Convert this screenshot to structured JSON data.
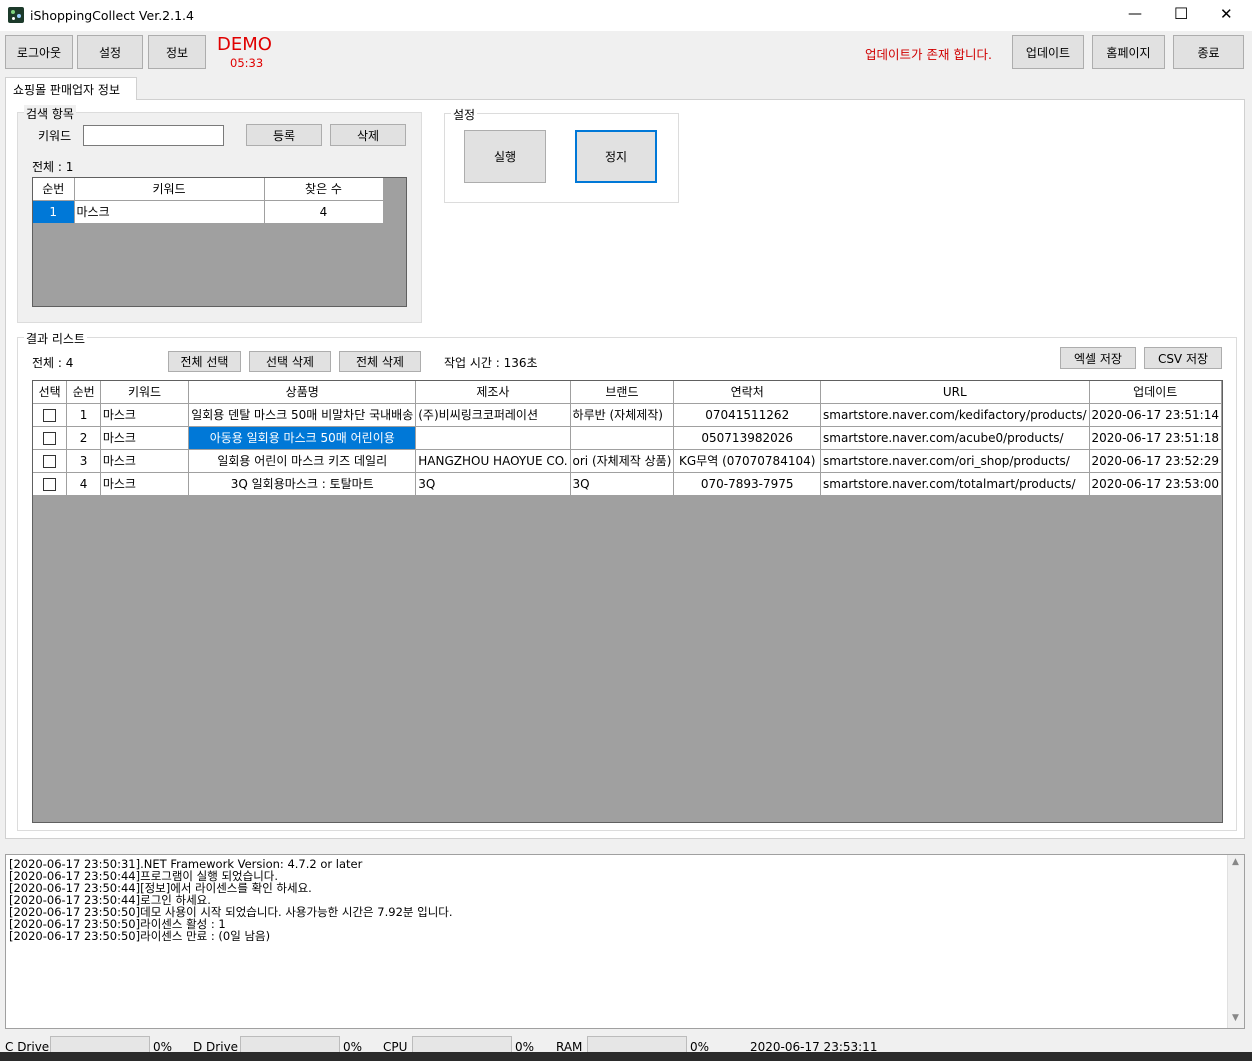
{
  "window": {
    "title": "iShoppingCollect Ver.2.1.4",
    "minimize": "—",
    "maximize": "☐",
    "close": "✕"
  },
  "toolbar": {
    "logout": "로그아웃",
    "settings": "설정",
    "info": "정보",
    "demo_label": "DEMO",
    "demo_timer": "05:33",
    "update_notice": "업데이트가 존재 합니다.",
    "update": "업데이트",
    "homepage": "홈페이지",
    "exit": "종료"
  },
  "tab": {
    "label": "쇼핑몰 판매업자 정보"
  },
  "search_group": {
    "title": "검색 항목",
    "keyword_label": "키워드",
    "keyword_value": "",
    "register": "등록",
    "delete": "삭제",
    "total": "전체 :  1",
    "columns": [
      "순번",
      "키워드",
      "찾은 수"
    ],
    "rows": [
      {
        "no": "1",
        "keyword": "마스크",
        "found": "4"
      }
    ]
  },
  "settings_group": {
    "title": "설정",
    "run": "실행",
    "stop": "정지"
  },
  "results_group": {
    "title": "결과 리스트",
    "total": "전체 :  4",
    "select_all": "전체 선택",
    "delete_selected": "선택 삭제",
    "delete_all": "전체 삭제",
    "work_time": "작업 시간 :  136초",
    "save_excel": "엑셀 저장",
    "save_csv": "CSV 저장",
    "columns": [
      "선택",
      "순번",
      "키워드",
      "상품명",
      "제조사",
      "브랜드",
      "연락처",
      "URL",
      "업데이트"
    ],
    "rows": [
      {
        "no": "1",
        "keyword": "마스크",
        "product": "일회용 덴탈 마스크 50매 비말차단 국내배송",
        "maker": "(주)비씨링크코퍼레이션",
        "brand": "하루반 (자체제작)",
        "contact": "07041511262",
        "url": "smartstore.naver.com/kedifactory/products/",
        "updated": "2020-06-17 23:51:14"
      },
      {
        "no": "2",
        "keyword": "마스크",
        "product": "아동용 일회용 마스크 50매 어린이용",
        "maker": "",
        "brand": "",
        "contact": "050713982026",
        "url": "smartstore.naver.com/acube0/products/",
        "updated": "2020-06-17 23:51:18"
      },
      {
        "no": "3",
        "keyword": "마스크",
        "product": "일회용 어린이 마스크 키즈 데일리",
        "maker": "HANGZHOU HAOYUE CO.",
        "brand": "ori (자체제작 상품)",
        "contact": "KG무역 (07070784104)",
        "url": "smartstore.naver.com/ori_shop/products/",
        "updated": "2020-06-17 23:52:29"
      },
      {
        "no": "4",
        "keyword": "마스크",
        "product": "3Q 일회용마스크 : 토탈마트",
        "maker": "3Q",
        "brand": "3Q",
        "contact": "070-7893-7975",
        "url": "smartstore.naver.com/totalmart/products/",
        "updated": "2020-06-17 23:53:00"
      }
    ]
  },
  "log": [
    "[2020-06-17 23:50:31].NET Framework Version: 4.7.2 or later",
    "[2020-06-17 23:50:44]프로그램이 실행 되었습니다.",
    "[2020-06-17 23:50:44][정보]에서 라이센스를 확인 하세요.",
    "[2020-06-17 23:50:44]로그인 하세요.",
    "[2020-06-17 23:50:50]데모 사용이 시작 되었습니다. 사용가능한 시간은 7.92분 입니다.",
    "[2020-06-17 23:50:50]라이센스 활성 : 1",
    "[2020-06-17 23:50:50]라이센스 만료 : (0일 남음)"
  ],
  "status": {
    "c_drive": "C Drive",
    "c_pct": "0%",
    "d_drive": "D Drive",
    "d_pct": "0%",
    "cpu": "CPU",
    "cpu_pct": "0%",
    "ram": "RAM",
    "ram_pct": "0%",
    "datetime": "2020-06-17 23:53:11"
  }
}
